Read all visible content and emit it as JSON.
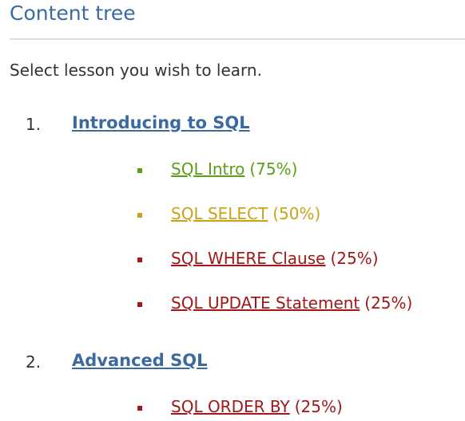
{
  "header": {
    "title": "Content tree"
  },
  "intro_text": "Select lesson you wish to learn.",
  "colors": {
    "accent": "#3b6aa0",
    "progress_high": "#5a9e1a",
    "progress_mid": "#c9a21a",
    "progress_low": "#a01818"
  },
  "sections": [
    {
      "number": "1.",
      "title": "Introducing to SQL",
      "lessons": [
        {
          "title": "SQL Intro",
          "progress": "(75%)",
          "status": "high"
        },
        {
          "title": "SQL SELECT",
          "progress": "(50%)",
          "status": "mid"
        },
        {
          "title": "SQL WHERE Clause",
          "progress": "(25%)",
          "status": "low"
        },
        {
          "title": "SQL UPDATE Statement",
          "progress": "(25%)",
          "status": "low"
        }
      ]
    },
    {
      "number": "2.",
      "title": "Advanced SQL",
      "lessons": [
        {
          "title": "SQL ORDER BY",
          "progress": "(25%)",
          "status": "low"
        }
      ]
    }
  ]
}
